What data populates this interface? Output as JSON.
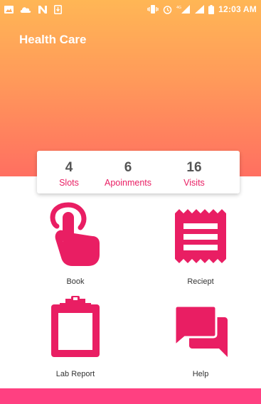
{
  "status_bar": {
    "time": "12:03 AM",
    "icons": [
      "image-icon",
      "cloud-icon",
      "signal-n-icon",
      "download-icon",
      "vibrate-icon",
      "alarm-icon",
      "4g-signal-icon",
      "signal-icon",
      "battery-icon"
    ]
  },
  "header": {
    "title": "Health Care"
  },
  "stats": [
    {
      "value": "4",
      "label": "Slots"
    },
    {
      "value": "6",
      "label": "Apoinments"
    },
    {
      "value": "16",
      "label": "Visits"
    }
  ],
  "menu": [
    {
      "label": "Book",
      "icon": "tap-hand-icon"
    },
    {
      "label": "Reciept",
      "icon": "receipt-icon"
    },
    {
      "label": "Lab Report",
      "icon": "clipboard-icon"
    },
    {
      "label": "Help",
      "icon": "chat-bubbles-icon"
    }
  ],
  "colors": {
    "header_gradient_top": "#ffb655",
    "header_gradient_bottom": "#ff6f61",
    "accent": "#e91e63",
    "bottom_bar": "#ff4081"
  }
}
